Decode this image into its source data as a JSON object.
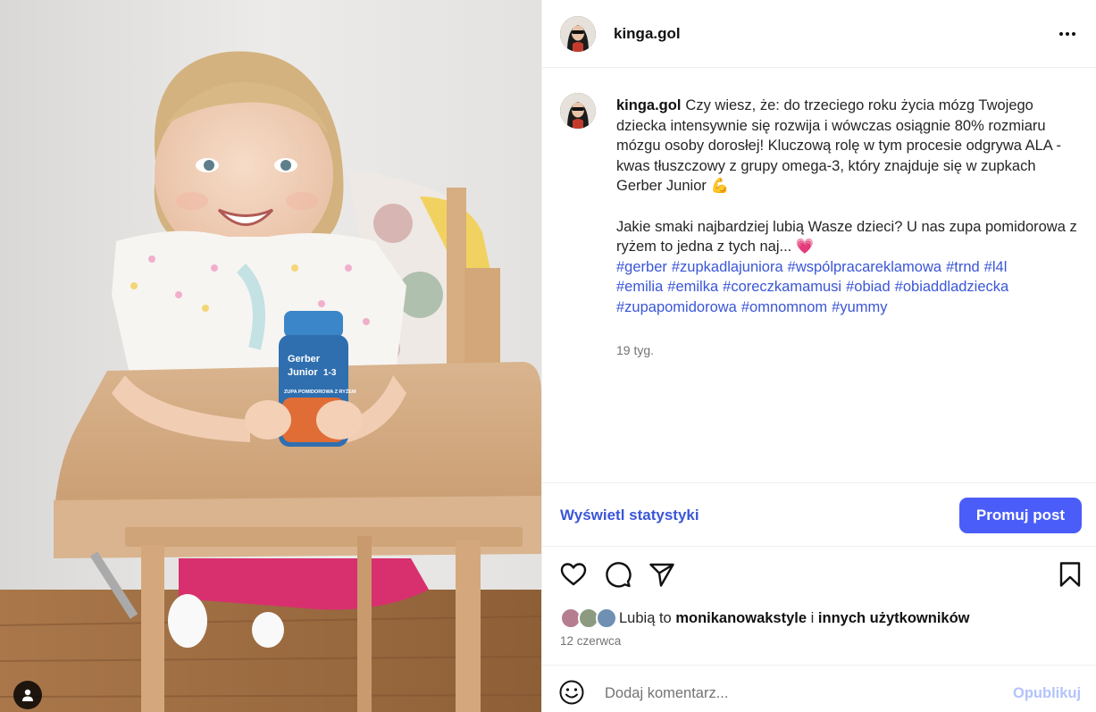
{
  "post": {
    "username": "kinga.gol",
    "caption_p1": "Czy wiesz, że: do trzeciego roku życia mózg Twojego dziecka intensywnie się rozwija i wówczas osiągnie 80% rozmiaru mózgu osoby dorosłej! Kluczową rolę w tym procesie odgrywa ALA - kwas tłuszczowy z grupy omega-3, który znajduje się w zupkach Gerber Junior",
    "caption_p1_emoji": "💪",
    "caption_p2": "Jakie smaki najbardziej lubią Wasze dzieci? U nas zupa pomidorowa z ryżem to jedna z tych naj...",
    "caption_p2_emoji": "💗",
    "hashtags": [
      "#gerber",
      "#zupkadlajuniora",
      "#wspólpracareklamowa",
      "#trnd",
      "#l4l",
      "#emilia",
      "#emilka",
      "#coreczkamamusi",
      "#obiad",
      "#obiaddladziecka",
      "#zupapomidorowa",
      "#omnomnom",
      "#yummy"
    ],
    "age": "19 tyg.",
    "jar_label": {
      "brand": "Gerber",
      "line": "Junior",
      "age": "1-3",
      "flavor": "ZUPA POMIDOROWA Z RYŻEM"
    }
  },
  "actions": {
    "stats_label": "Wyświetl statystyki",
    "promote_label": "Promuj post"
  },
  "likes": {
    "prefix": "Lubią to",
    "user": "monikanowakstyle",
    "connector": "i",
    "others": "innych użytkowników"
  },
  "date": "12 czerwca",
  "comment": {
    "placeholder": "Dodaj komentarz...",
    "publish_label": "Opublikuj"
  },
  "icons": {
    "more": "more-horizontal-icon",
    "like": "heart-icon",
    "comment": "comment-icon",
    "share": "send-icon",
    "save": "bookmark-icon",
    "emoji": "emoji-icon",
    "tag": "user-tag-icon"
  },
  "colors": {
    "link": "#3b56d6",
    "button": "#4a5df9",
    "muted": "#737373",
    "publish_disabled": "#b3c3fb"
  }
}
